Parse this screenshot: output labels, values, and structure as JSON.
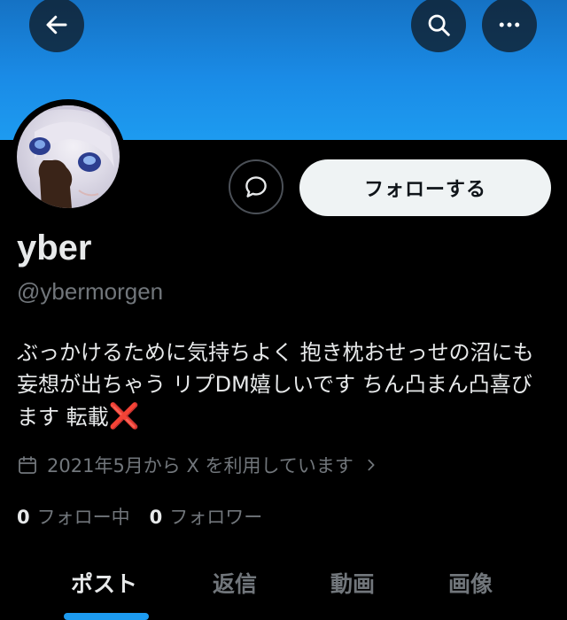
{
  "profile": {
    "display_name": "yber",
    "handle": "@ybermorgen",
    "bio_text": "ぶっかけるために気持ちよく 抱き枕おせっせの沼にも 妄想が出ちゃう リプDM嬉しいです ちん凸まん凸喜びます 転載",
    "bio_mark": "❌",
    "joined": "2021年5月から X を利用しています",
    "following_count": "0",
    "following_label": "フォロー中",
    "followers_count": "0",
    "followers_label": "フォロワー"
  },
  "actions": {
    "follow_label": "フォローする"
  },
  "tabs": [
    {
      "label": "ポスト",
      "active": true
    },
    {
      "label": "返信",
      "active": false
    },
    {
      "label": "動画",
      "active": false
    },
    {
      "label": "画像",
      "active": false
    }
  ],
  "icons": {
    "back": "arrow-left-icon",
    "search": "search-icon",
    "more": "more-horizontal-icon",
    "dm": "message-bubble-icon",
    "calendar": "calendar-icon",
    "chevron": "chevron-right-icon"
  },
  "colors": {
    "banner": "#1d9bf0",
    "accent": "#1d9bf0",
    "muted": "#71767b",
    "text": "#e7e9ea",
    "follow_bg": "#eff3f4",
    "red_mark": "#f4212e"
  }
}
